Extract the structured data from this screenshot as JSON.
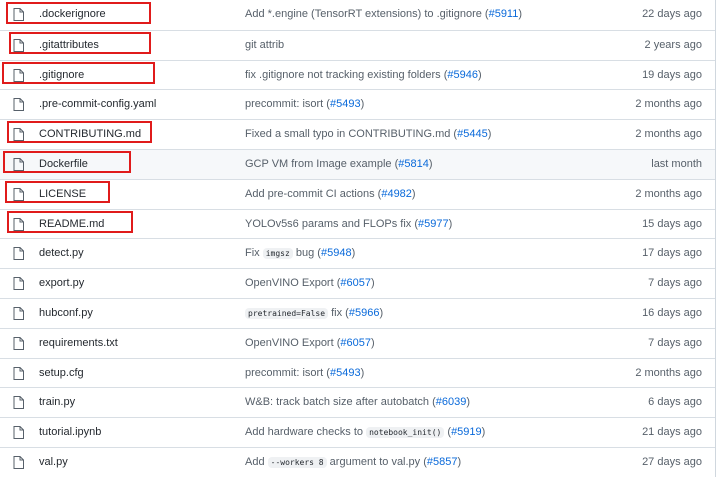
{
  "files": [
    {
      "name": ".dockerignore",
      "msg_parts": [
        {
          "t": "text",
          "v": "Add *.engine (TensorRT extensions) to .gitignore ("
        },
        {
          "t": "link",
          "v": "#5911"
        },
        {
          "t": "text",
          "v": ")"
        }
      ],
      "age": "22 days ago"
    },
    {
      "name": ".gitattributes",
      "msg_parts": [
        {
          "t": "text",
          "v": "git attrib"
        }
      ],
      "age": "2 years ago"
    },
    {
      "name": ".gitignore",
      "msg_parts": [
        {
          "t": "text",
          "v": "fix .gitignore not tracking existing folders ("
        },
        {
          "t": "link",
          "v": "#5946"
        },
        {
          "t": "text",
          "v": ")"
        }
      ],
      "age": "19 days ago"
    },
    {
      "name": ".pre-commit-config.yaml",
      "msg_parts": [
        {
          "t": "text",
          "v": "precommit: isort ("
        },
        {
          "t": "link",
          "v": "#5493"
        },
        {
          "t": "text",
          "v": ")"
        }
      ],
      "age": "2 months ago"
    },
    {
      "name": "CONTRIBUTING.md",
      "msg_parts": [
        {
          "t": "text",
          "v": "Fixed a small typo in CONTRIBUTING.md ("
        },
        {
          "t": "link",
          "v": "#5445"
        },
        {
          "t": "text",
          "v": ")"
        }
      ],
      "age": "2 months ago"
    },
    {
      "name": "Dockerfile",
      "msg_parts": [
        {
          "t": "text",
          "v": "GCP VM from Image example ("
        },
        {
          "t": "link",
          "v": "#5814"
        },
        {
          "t": "text",
          "v": ")"
        }
      ],
      "age": "last month"
    },
    {
      "name": "LICENSE",
      "msg_parts": [
        {
          "t": "text",
          "v": "Add pre-commit CI actions ("
        },
        {
          "t": "link",
          "v": "#4982"
        },
        {
          "t": "text",
          "v": ")"
        }
      ],
      "age": "2 months ago"
    },
    {
      "name": "README.md",
      "msg_parts": [
        {
          "t": "text",
          "v": "YOLOv5s6 params and FLOPs fix ("
        },
        {
          "t": "link",
          "v": "#5977"
        },
        {
          "t": "text",
          "v": ")"
        }
      ],
      "age": "15 days ago"
    },
    {
      "name": "detect.py",
      "msg_parts": [
        {
          "t": "text",
          "v": "Fix "
        },
        {
          "t": "code",
          "v": "imgsz"
        },
        {
          "t": "text",
          "v": " bug ("
        },
        {
          "t": "link",
          "v": "#5948"
        },
        {
          "t": "text",
          "v": ")"
        }
      ],
      "age": "17 days ago"
    },
    {
      "name": "export.py",
      "msg_parts": [
        {
          "t": "text",
          "v": "OpenVINO Export ("
        },
        {
          "t": "link",
          "v": "#6057"
        },
        {
          "t": "text",
          "v": ")"
        }
      ],
      "age": "7 days ago"
    },
    {
      "name": "hubconf.py",
      "msg_parts": [
        {
          "t": "code",
          "v": "pretrained=False"
        },
        {
          "t": "text",
          "v": " fix ("
        },
        {
          "t": "link",
          "v": "#5966"
        },
        {
          "t": "text",
          "v": ")"
        }
      ],
      "age": "16 days ago"
    },
    {
      "name": "requirements.txt",
      "msg_parts": [
        {
          "t": "text",
          "v": "OpenVINO Export ("
        },
        {
          "t": "link",
          "v": "#6057"
        },
        {
          "t": "text",
          "v": ")"
        }
      ],
      "age": "7 days ago"
    },
    {
      "name": "setup.cfg",
      "msg_parts": [
        {
          "t": "text",
          "v": "precommit: isort ("
        },
        {
          "t": "link",
          "v": "#5493"
        },
        {
          "t": "text",
          "v": ")"
        }
      ],
      "age": "2 months ago"
    },
    {
      "name": "train.py",
      "msg_parts": [
        {
          "t": "text",
          "v": "W&B: track batch size after autobatch ("
        },
        {
          "t": "link",
          "v": "#6039"
        },
        {
          "t": "text",
          "v": ")"
        }
      ],
      "age": "6 days ago"
    },
    {
      "name": "tutorial.ipynb",
      "msg_parts": [
        {
          "t": "text",
          "v": "Add hardware checks to "
        },
        {
          "t": "code",
          "v": "notebook_init()"
        },
        {
          "t": "text",
          "v": " ("
        },
        {
          "t": "link",
          "v": "#5919"
        },
        {
          "t": "text",
          "v": ")"
        }
      ],
      "age": "21 days ago"
    },
    {
      "name": "val.py",
      "msg_parts": [
        {
          "t": "text",
          "v": "Add "
        },
        {
          "t": "code",
          "v": "--workers 8"
        },
        {
          "t": "text",
          "v": " argument to val.py ("
        },
        {
          "t": "link",
          "v": "#5857"
        },
        {
          "t": "text",
          "v": ")"
        }
      ],
      "age": "27 days ago"
    }
  ],
  "hover_row": "Dockerfile",
  "highlighted_files": [
    ".dockerignore",
    ".gitattributes",
    ".gitignore",
    "CONTRIBUTING.md",
    "Dockerfile",
    "LICENSE",
    "README.md"
  ],
  "colors": {
    "highlight": "#e01b1b",
    "link": "#0969da",
    "muted_text": "#57606a",
    "border": "#d8dee4",
    "icon": "#57606a"
  },
  "icons": {
    "file": "file-icon"
  }
}
